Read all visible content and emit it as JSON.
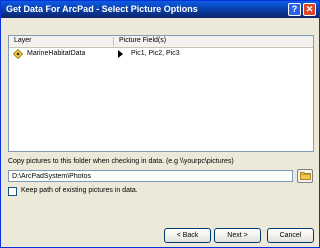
{
  "window": {
    "title": "Get Data For ArcPad - Select Picture Options",
    "help_label": "?",
    "close_label": "✕"
  },
  "list": {
    "columns": [
      "Layer",
      "Picture Field(s)"
    ],
    "rows": [
      {
        "layer": "MarineHabitatData",
        "picture_fields": "Pic1, Pic2, Pic3"
      }
    ]
  },
  "folder": {
    "label": "Copy pictures to this folder when checking in data. (e.g \\\\yourpc\\pictures)",
    "path": "D:\\ArcPadSystem\\Photos"
  },
  "keep_path": {
    "label": "Keep path of existing pictures in data.",
    "checked": false
  },
  "buttons": {
    "back": "< Back",
    "next": "Next >",
    "cancel": "Cancel"
  },
  "icons": {
    "layer": "point-layer-icon",
    "browse": "folder-icon"
  },
  "colors": {
    "titlebar": "#0a5ce6",
    "dialog_bg": "#ece9d8",
    "layer_icon_fill": "#ffd23c"
  }
}
